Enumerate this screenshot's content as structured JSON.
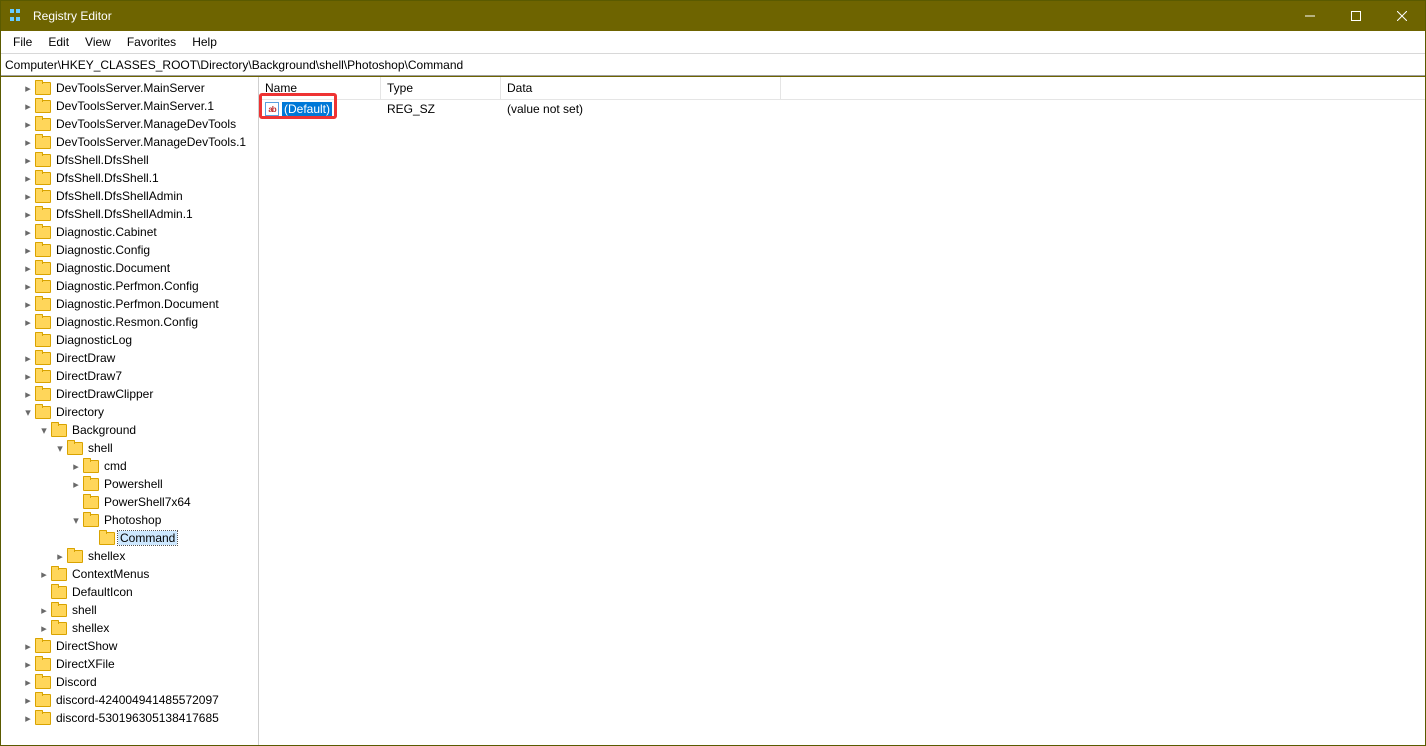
{
  "window": {
    "title": "Registry Editor"
  },
  "menu": {
    "items": [
      "File",
      "Edit",
      "View",
      "Favorites",
      "Help"
    ]
  },
  "address": {
    "path": "Computer\\HKEY_CLASSES_ROOT\\Directory\\Background\\shell\\Photoshop\\Command"
  },
  "tree": [
    {
      "label": "DevToolsServer.MainServer",
      "depth": 1,
      "arrow": "r"
    },
    {
      "label": "DevToolsServer.MainServer.1",
      "depth": 1,
      "arrow": "r"
    },
    {
      "label": "DevToolsServer.ManageDevTools",
      "depth": 1,
      "arrow": "r"
    },
    {
      "label": "DevToolsServer.ManageDevTools.1",
      "depth": 1,
      "arrow": "r"
    },
    {
      "label": "DfsShell.DfsShell",
      "depth": 1,
      "arrow": "r"
    },
    {
      "label": "DfsShell.DfsShell.1",
      "depth": 1,
      "arrow": "r"
    },
    {
      "label": "DfsShell.DfsShellAdmin",
      "depth": 1,
      "arrow": "r"
    },
    {
      "label": "DfsShell.DfsShellAdmin.1",
      "depth": 1,
      "arrow": "r"
    },
    {
      "label": "Diagnostic.Cabinet",
      "depth": 1,
      "arrow": "r"
    },
    {
      "label": "Diagnostic.Config",
      "depth": 1,
      "arrow": "r"
    },
    {
      "label": "Diagnostic.Document",
      "depth": 1,
      "arrow": "r"
    },
    {
      "label": "Diagnostic.Perfmon.Config",
      "depth": 1,
      "arrow": "r"
    },
    {
      "label": "Diagnostic.Perfmon.Document",
      "depth": 1,
      "arrow": "r"
    },
    {
      "label": "Diagnostic.Resmon.Config",
      "depth": 1,
      "arrow": "r"
    },
    {
      "label": "DiagnosticLog",
      "depth": 1,
      "arrow": ""
    },
    {
      "label": "DirectDraw",
      "depth": 1,
      "arrow": "r"
    },
    {
      "label": "DirectDraw7",
      "depth": 1,
      "arrow": "r"
    },
    {
      "label": "DirectDrawClipper",
      "depth": 1,
      "arrow": "r"
    },
    {
      "label": "Directory",
      "depth": 1,
      "arrow": "d"
    },
    {
      "label": "Background",
      "depth": 2,
      "arrow": "d"
    },
    {
      "label": "shell",
      "depth": 3,
      "arrow": "d"
    },
    {
      "label": "cmd",
      "depth": 4,
      "arrow": "r"
    },
    {
      "label": "Powershell",
      "depth": 4,
      "arrow": "r"
    },
    {
      "label": "PowerShell7x64",
      "depth": 4,
      "arrow": ""
    },
    {
      "label": "Photoshop",
      "depth": 4,
      "arrow": "d"
    },
    {
      "label": "Command",
      "depth": 5,
      "arrow": "",
      "selected": true
    },
    {
      "label": "shellex",
      "depth": 3,
      "arrow": "r"
    },
    {
      "label": "ContextMenus",
      "depth": 2,
      "arrow": "r"
    },
    {
      "label": "DefaultIcon",
      "depth": 2,
      "arrow": ""
    },
    {
      "label": "shell",
      "depth": 2,
      "arrow": "r"
    },
    {
      "label": "shellex",
      "depth": 2,
      "arrow": "r"
    },
    {
      "label": "DirectShow",
      "depth": 1,
      "arrow": "r"
    },
    {
      "label": "DirectXFile",
      "depth": 1,
      "arrow": "r"
    },
    {
      "label": "Discord",
      "depth": 1,
      "arrow": "r"
    },
    {
      "label": "discord-424004941485572097",
      "depth": 1,
      "arrow": "r"
    },
    {
      "label": "discord-530196305138417685",
      "depth": 1,
      "arrow": "r"
    }
  ],
  "columns": {
    "name": "Name",
    "type": "Type",
    "data": "Data"
  },
  "values": [
    {
      "name": "(Default)",
      "type": "REG_SZ",
      "data": "(value not set)",
      "selected": true
    }
  ],
  "highlight": {
    "on_value_index": 0
  }
}
